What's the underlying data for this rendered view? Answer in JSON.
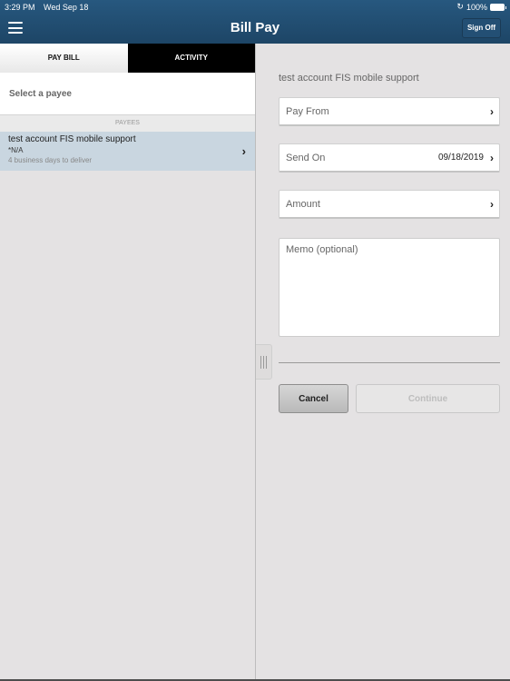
{
  "status_bar": {
    "time": "3:29 PM",
    "date": "Wed Sep 18",
    "battery": "100%"
  },
  "header": {
    "title": "Bill Pay",
    "sign_off": "Sign Off",
    "menu_icon": "hamburger-icon"
  },
  "tabs": [
    {
      "label": "PAY BILL",
      "active": true
    },
    {
      "label": "ACTIVITY",
      "active": false
    }
  ],
  "left": {
    "select_payee": "Select a payee",
    "payees_header": "PAYEES",
    "payees": [
      {
        "name": "test account FIS mobile support",
        "account": "*N/A",
        "delivery": "4 business days to deliver"
      }
    ]
  },
  "form": {
    "payee_title": "test account FIS mobile support",
    "pay_from_label": "Pay From",
    "send_on_label": "Send On",
    "send_on_value": "09/18/2019",
    "amount_label": "Amount",
    "memo_placeholder": "Memo (optional)",
    "memo_value": "",
    "cancel_label": "Cancel",
    "continue_label": "Continue"
  },
  "colors": {
    "header_bg": "#1d4566",
    "selected_row": "#c9d6e0",
    "page_bg": "#e4e2e3"
  }
}
